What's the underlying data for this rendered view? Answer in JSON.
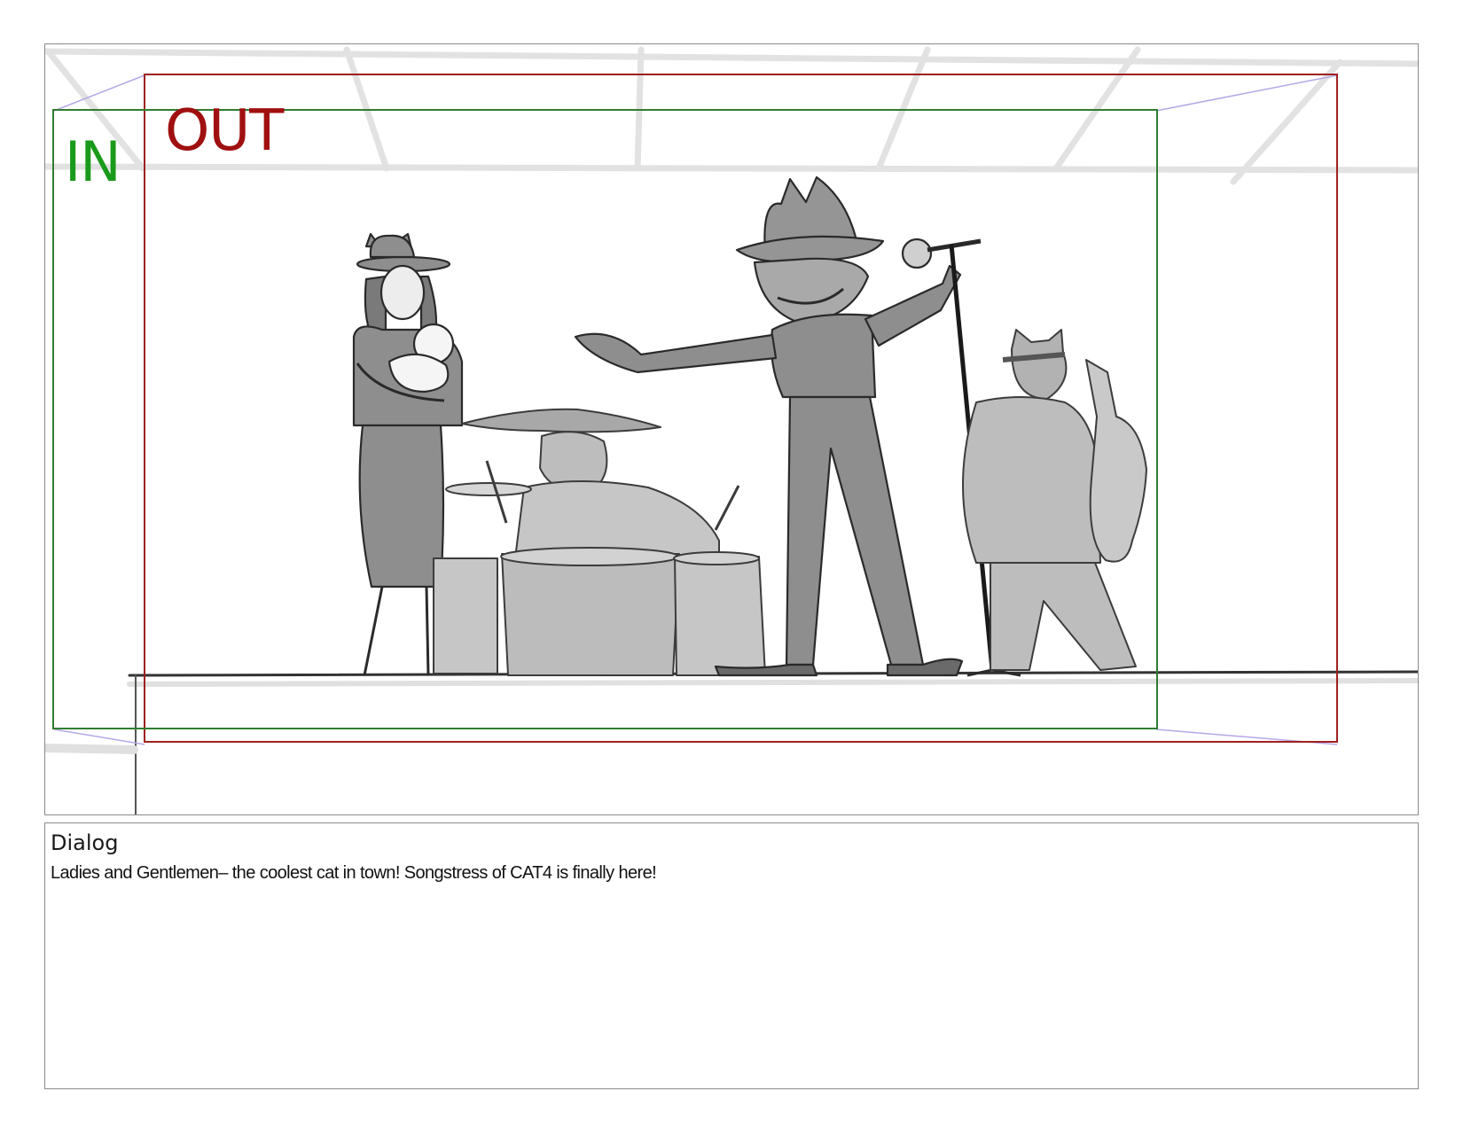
{
  "panel": {
    "in_label": "IN",
    "out_label": "OUT",
    "in_color": "#1a9a1a",
    "out_color": "#a01010",
    "in_frame_color": "#2f7d2f",
    "out_frame_color": "#a02020",
    "guide_color": "#b3a8e6"
  },
  "dialog": {
    "heading": "Dialog",
    "text": "Ladies and Gentlemen– the coolest cat in town! Songstress of CAT4 is finally here!"
  }
}
